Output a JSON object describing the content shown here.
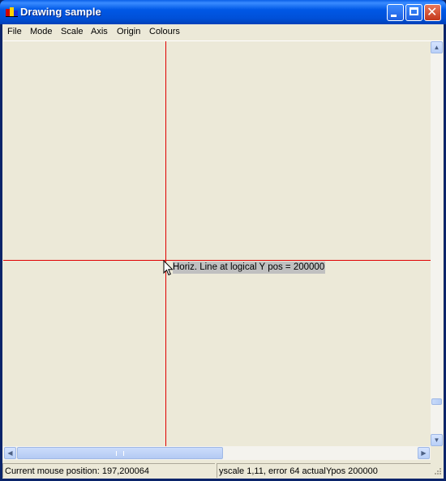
{
  "window": {
    "title": "Drawing sample"
  },
  "menu": {
    "items": [
      "File",
      "Mode",
      "Scale",
      "Axis",
      "Origin",
      "Colours"
    ]
  },
  "canvas": {
    "background": "#ece9d8",
    "line_color": "#e00000",
    "label": "Horiz. Line at logical Y pos = 200000",
    "label_background": "#c0c0c0"
  },
  "status": {
    "mouse_position": "Current mouse position: 197,200064",
    "scale_info": "yscale 1,11, error 64 actualYpos 200000"
  },
  "icons": {
    "app": "app-icon",
    "minimize": "minimize-icon",
    "maximize": "maximize-icon",
    "close": "close-icon",
    "scroll_up": "arrow-up-icon",
    "scroll_down": "arrow-down-icon",
    "scroll_left": "arrow-left-icon",
    "scroll_right": "arrow-right-icon",
    "cursor": "mouse-pointer-icon",
    "grip": "resize-grip-icon"
  }
}
